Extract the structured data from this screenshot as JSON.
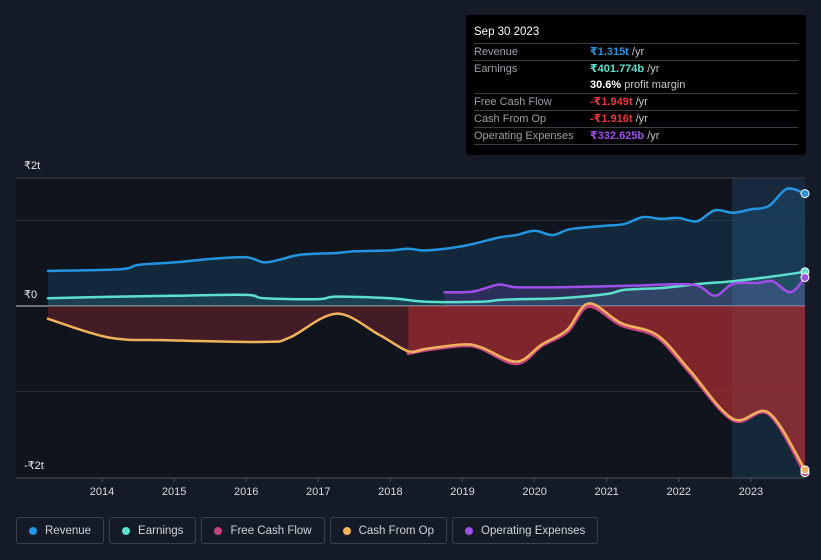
{
  "chart_data": {
    "type": "area",
    "title": "",
    "xlabel": "",
    "ylabel": "",
    "unit": "trillion INR",
    "ylim": [
      -2,
      2
    ],
    "xlim": [
      2013.0,
      2023.75
    ],
    "y_tick_labels": [
      {
        "value": 2,
        "label": "₹2t"
      },
      {
        "value": 0,
        "label": "₹0"
      },
      {
        "value": -2,
        "label": "-₹2t"
      }
    ],
    "x_ticks": [
      2014,
      2015,
      2016,
      2017,
      2018,
      2019,
      2020,
      2021,
      2022,
      2023
    ],
    "x_tick_labels": [
      "2014",
      "2015",
      "2016",
      "2017",
      "2018",
      "2019",
      "2020",
      "2021",
      "2022",
      "2023"
    ],
    "highlight_range": [
      2022.75,
      2023.75
    ],
    "grid": true,
    "legend_position": "bottom",
    "series": [
      {
        "name": "Revenue",
        "color": "#2394df",
        "x": [
          2013.25,
          2014.25,
          2014.5,
          2015.0,
          2015.5,
          2016.0,
          2016.25,
          2016.5,
          2016.75,
          2017.25,
          2017.5,
          2018.0,
          2018.25,
          2018.5,
          2019.0,
          2019.5,
          2019.75,
          2020.0,
          2020.25,
          2020.5,
          2021.0,
          2021.25,
          2021.5,
          2021.75,
          2022.0,
          2022.25,
          2022.5,
          2022.75,
          2023.0,
          2023.25,
          2023.5,
          2023.75
        ],
        "values": [
          0.41,
          0.43,
          0.48,
          0.51,
          0.55,
          0.57,
          0.51,
          0.55,
          0.6,
          0.62,
          0.64,
          0.65,
          0.67,
          0.65,
          0.7,
          0.8,
          0.83,
          0.88,
          0.83,
          0.9,
          0.94,
          0.96,
          1.04,
          1.02,
          1.03,
          0.99,
          1.12,
          1.09,
          1.13,
          1.17,
          1.37,
          1.315
        ]
      },
      {
        "name": "Earnings",
        "color": "#5ce0cb",
        "x": [
          2013.25,
          2014.25,
          2015.0,
          2016.0,
          2016.25,
          2017.0,
          2017.25,
          2018.0,
          2018.5,
          2019.25,
          2019.5,
          2019.8,
          2020.35,
          2021.0,
          2021.25,
          2021.75,
          2022.3,
          2022.75,
          2023.25,
          2023.75
        ],
        "values": [
          0.09,
          0.11,
          0.12,
          0.13,
          0.09,
          0.08,
          0.11,
          0.09,
          0.05,
          0.05,
          0.07,
          0.08,
          0.09,
          0.14,
          0.19,
          0.21,
          0.26,
          0.29,
          0.34,
          0.4
        ]
      },
      {
        "name": "Free Cash Flow",
        "color": "#c7447f",
        "x": [
          2018.25,
          2018.5,
          2019.0,
          2019.25,
          2019.75,
          2020.1,
          2020.45,
          2020.75,
          2021.2,
          2021.7,
          2022.15,
          2022.75,
          2023.25,
          2023.75
        ],
        "values": [
          -0.55,
          -0.51,
          -0.46,
          -0.49,
          -0.67,
          -0.46,
          -0.3,
          0.0,
          -0.22,
          -0.36,
          -0.77,
          -1.33,
          -1.26,
          -1.949
        ]
      },
      {
        "name": "Cash From Op",
        "color": "#f1b25c",
        "x": [
          2013.25,
          2014.1,
          2014.9,
          2016.25,
          2016.6,
          2017.25,
          2017.85,
          2018.25,
          2018.5,
          2019.0,
          2019.25,
          2019.75,
          2020.1,
          2020.45,
          2020.75,
          2021.2,
          2021.7,
          2022.15,
          2022.75,
          2023.25,
          2023.75
        ],
        "values": [
          -0.15,
          -0.37,
          -0.4,
          -0.42,
          -0.37,
          -0.09,
          -0.34,
          -0.53,
          -0.5,
          -0.45,
          -0.48,
          -0.65,
          -0.45,
          -0.28,
          0.03,
          -0.2,
          -0.34,
          -0.75,
          -1.32,
          -1.25,
          -1.916
        ]
      },
      {
        "name": "Operating Expenses",
        "color": "#a04ee8",
        "x": [
          2018.75,
          2019.15,
          2019.5,
          2019.75,
          2020.35,
          2021.45,
          2022.2,
          2022.5,
          2022.75,
          2023.1,
          2023.3,
          2023.55,
          2023.75
        ],
        "values": [
          0.16,
          0.17,
          0.25,
          0.22,
          0.22,
          0.24,
          0.25,
          0.12,
          0.26,
          0.27,
          0.29,
          0.16,
          0.333
        ]
      }
    ]
  },
  "tooltip": {
    "date": "Sep 30 2023",
    "rows": [
      {
        "label": "Revenue",
        "value": "₹1.315t",
        "suffix": " /yr",
        "color": "#2394df"
      },
      {
        "label": "Earnings",
        "value": "₹401.774b",
        "suffix": " /yr",
        "color": "#5ce0cb"
      },
      {
        "label": "",
        "value": "30.6%",
        "suffix": " profit margin",
        "color": "#ffffff"
      },
      {
        "label": "Free Cash Flow",
        "value": "-₹1.949t",
        "suffix": " /yr",
        "color": "#e8383d"
      },
      {
        "label": "Cash From Op",
        "value": "-₹1.916t",
        "suffix": " /yr",
        "color": "#e8383d"
      },
      {
        "label": "Operating Expenses",
        "value": "₹332.625b",
        "suffix": " /yr",
        "color": "#a04ee8"
      }
    ]
  },
  "legend": [
    {
      "label": "Revenue",
      "color": "#2394df"
    },
    {
      "label": "Earnings",
      "color": "#5ce0cb"
    },
    {
      "label": "Free Cash Flow",
      "color": "#c7447f"
    },
    {
      "label": "Cash From Op",
      "color": "#f1b25c"
    },
    {
      "label": "Operating Expenses",
      "color": "#a04ee8"
    }
  ]
}
